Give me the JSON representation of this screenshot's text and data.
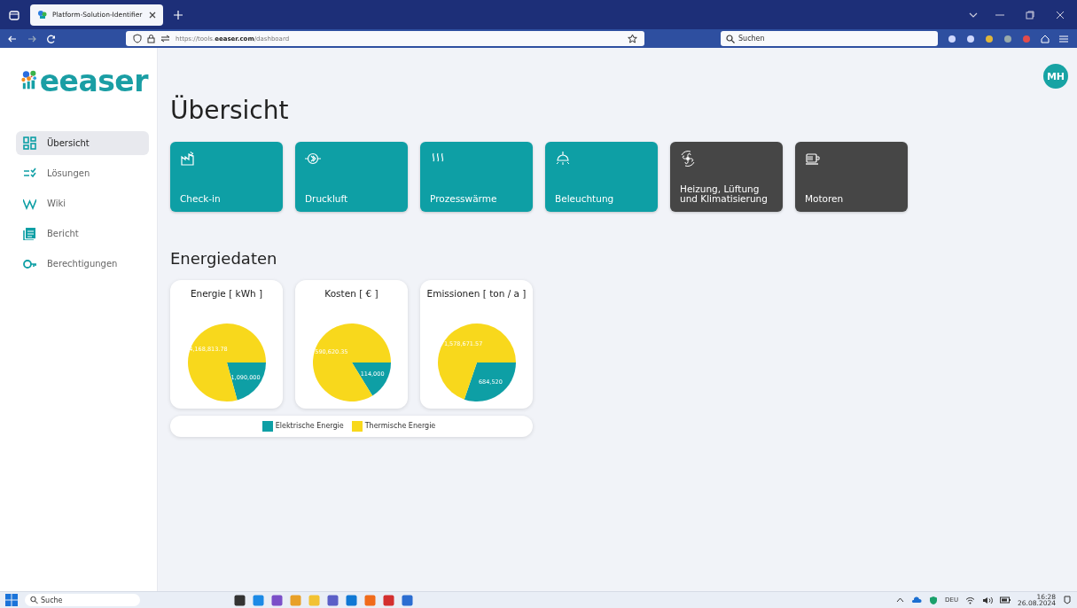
{
  "browser": {
    "tab_title": "Platform-Solution-Identifier",
    "url": "https://tools.**eeaser.com**/dashboard",
    "search": {
      "placeholder": "Suchen"
    }
  },
  "logo": {
    "text": "eeaser"
  },
  "avatar": {
    "initials": "MH"
  },
  "sidebar": {
    "items": [
      {
        "label": "Übersicht",
        "selected": true
      },
      {
        "label": "Lösungen",
        "selected": false
      },
      {
        "label": "Wiki",
        "selected": false
      },
      {
        "label": "Bericht",
        "selected": false
      },
      {
        "label": "Berechtigungen",
        "selected": false
      }
    ]
  },
  "page_title": "Übersicht",
  "tiles": [
    {
      "label": "Check-in",
      "color": "#0e9fa5"
    },
    {
      "label": "Druckluft",
      "color": "#0e9fa5"
    },
    {
      "label": "Prozesswärme",
      "color": "#0e9fa5"
    },
    {
      "label": "Beleuchtung",
      "color": "#0e9fa5"
    },
    {
      "label": "Heizung, Lüftung und Klimatisierung",
      "color": "#464646"
    },
    {
      "label": "Motoren",
      "color": "#464646"
    }
  ],
  "section_title": "Energiedaten",
  "charts": [
    {
      "chart_data": {
        "type": "pie",
        "title": "Energie [ kWh ]",
        "values": [
          1090000,
          4168813.78
        ],
        "data_labels": true,
        "value_labels": [
          "1,090,000",
          "4,168,813.78"
        ]
      }
    },
    {
      "chart_data": {
        "type": "pie",
        "title": "Kosten [ € ]",
        "values": [
          114000,
          590620.35
        ],
        "data_labels": true,
        "value_labels": [
          "114,000",
          "590,620.35"
        ]
      }
    },
    {
      "chart_data": {
        "type": "pie",
        "title": "Emissionen [ ton / a ]",
        "values": [
          684520,
          1578671.57
        ],
        "data_labels": true,
        "value_labels": [
          "684,520",
          "1,578,671.57"
        ]
      }
    }
  ],
  "legend": [
    {
      "label": "Elektrische Energie",
      "color": "#0e9fa5"
    },
    {
      "label": "Thermische Energie",
      "color": "#f8d81c"
    }
  ],
  "taskbar": {
    "search": {
      "placeholder": "Suche"
    },
    "language": "DEU",
    "time": "16:28",
    "date": "26.08.2024"
  }
}
